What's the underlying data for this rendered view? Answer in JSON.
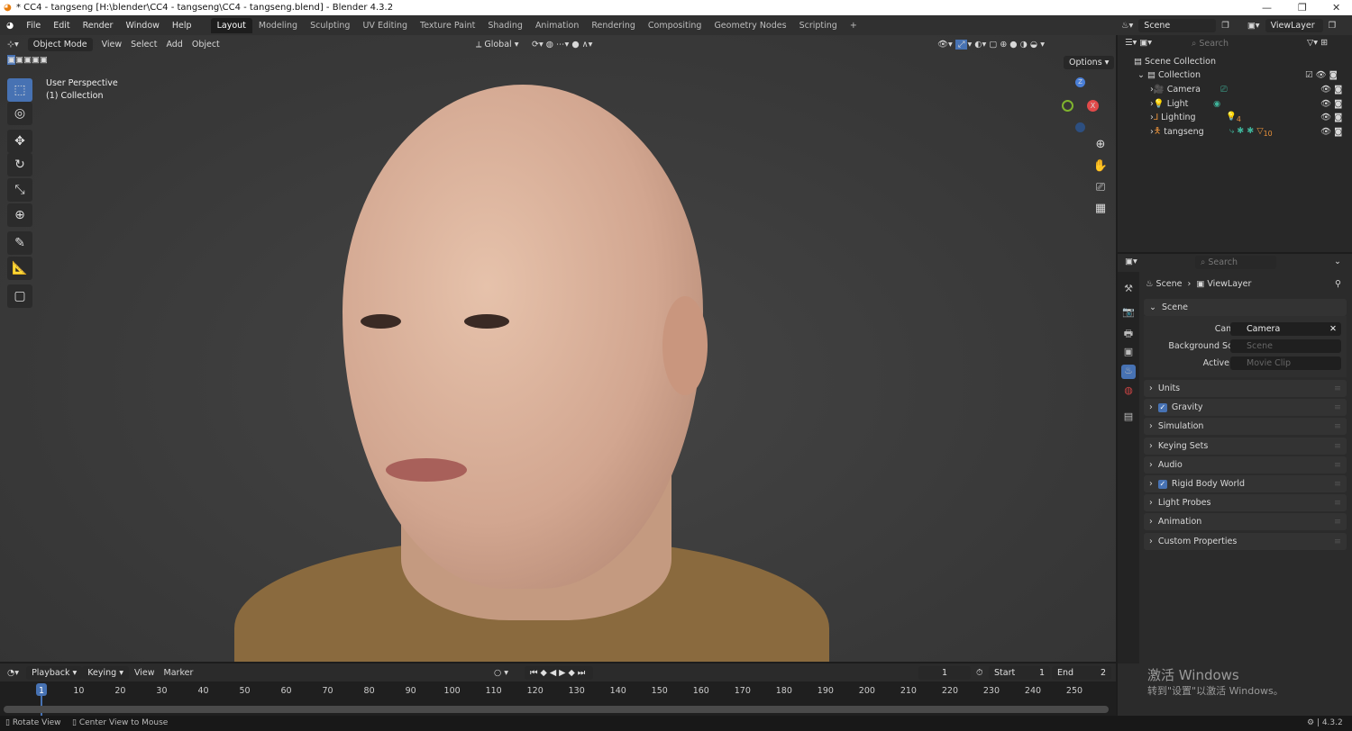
{
  "window": {
    "title": "* CC4 - tangseng [H:\\blender\\CC4 - tangseng\\CC4 - tangseng.blend] - Blender 4.3.2"
  },
  "menu": [
    "File",
    "Edit",
    "Render",
    "Window",
    "Help"
  ],
  "workspaces": [
    "Layout",
    "Modeling",
    "Sculpting",
    "UV Editing",
    "Texture Paint",
    "Shading",
    "Animation",
    "Rendering",
    "Compositing",
    "Geometry Nodes",
    "Scripting",
    "+"
  ],
  "viewport": {
    "mode": "Object Mode",
    "menus": [
      "View",
      "Select",
      "Add",
      "Object"
    ],
    "transform": "Global",
    "options": "Options",
    "perspective": "User Perspective",
    "collection": "(1) Collection",
    "axes": {
      "x": "X",
      "y": "Y",
      "z": "Z"
    }
  },
  "topright": {
    "scene": "Scene",
    "viewlayer": "ViewLayer"
  },
  "outliner": {
    "search_placeholder": "Search",
    "root": "Scene Collection",
    "collection": "Collection",
    "items": [
      {
        "name": "Camera",
        "icon": "camera-icon"
      },
      {
        "name": "Light",
        "icon": "light-icon"
      },
      {
        "name": "Lighting",
        "icon": "empty-icon",
        "badge": "4"
      },
      {
        "name": "tangseng",
        "icon": "armature-icon",
        "badge": "10"
      }
    ]
  },
  "properties": {
    "search_placeholder": "Search",
    "breadcrumb": [
      "Scene",
      "ViewLayer"
    ],
    "scene_panel": "Scene",
    "fields": [
      {
        "label": "Camera",
        "value": "Camera"
      },
      {
        "label": "Background Scene",
        "value": "Scene"
      },
      {
        "label": "Active Clip",
        "value": "Movie Clip"
      }
    ],
    "panels": [
      {
        "label": "Units",
        "checkbox": false
      },
      {
        "label": "Gravity",
        "checkbox": true
      },
      {
        "label": "Simulation",
        "checkbox": false
      },
      {
        "label": "Keying Sets",
        "checkbox": false
      },
      {
        "label": "Audio",
        "checkbox": false
      },
      {
        "label": "Rigid Body World",
        "checkbox": true
      },
      {
        "label": "Light Probes",
        "checkbox": false
      },
      {
        "label": "Animation",
        "checkbox": false
      },
      {
        "label": "Custom Properties",
        "checkbox": false
      }
    ]
  },
  "timeline": {
    "menus": [
      "Playback",
      "Keying",
      "View",
      "Marker"
    ],
    "current_frame": "1",
    "start_label": "Start",
    "start": "1",
    "end_label": "End",
    "end": "2",
    "ticks": [
      "1",
      "10",
      "20",
      "30",
      "40",
      "50",
      "60",
      "70",
      "80",
      "90",
      "100",
      "110",
      "120",
      "130",
      "140",
      "150",
      "160",
      "170",
      "180",
      "190",
      "200",
      "210",
      "220",
      "230",
      "240",
      "250"
    ]
  },
  "watermark": {
    "line1": "激活 Windows",
    "line2": "转到\"设置\"以激活 Windows。"
  },
  "status": {
    "left1": "Rotate View",
    "left2": "Center View to Mouse",
    "version": "4.3.2"
  },
  "colors": {
    "accent": "#4772b3",
    "x_axis": "#e14a4a",
    "y_axis": "#7fb32e",
    "z_axis": "#4a7fd8"
  }
}
